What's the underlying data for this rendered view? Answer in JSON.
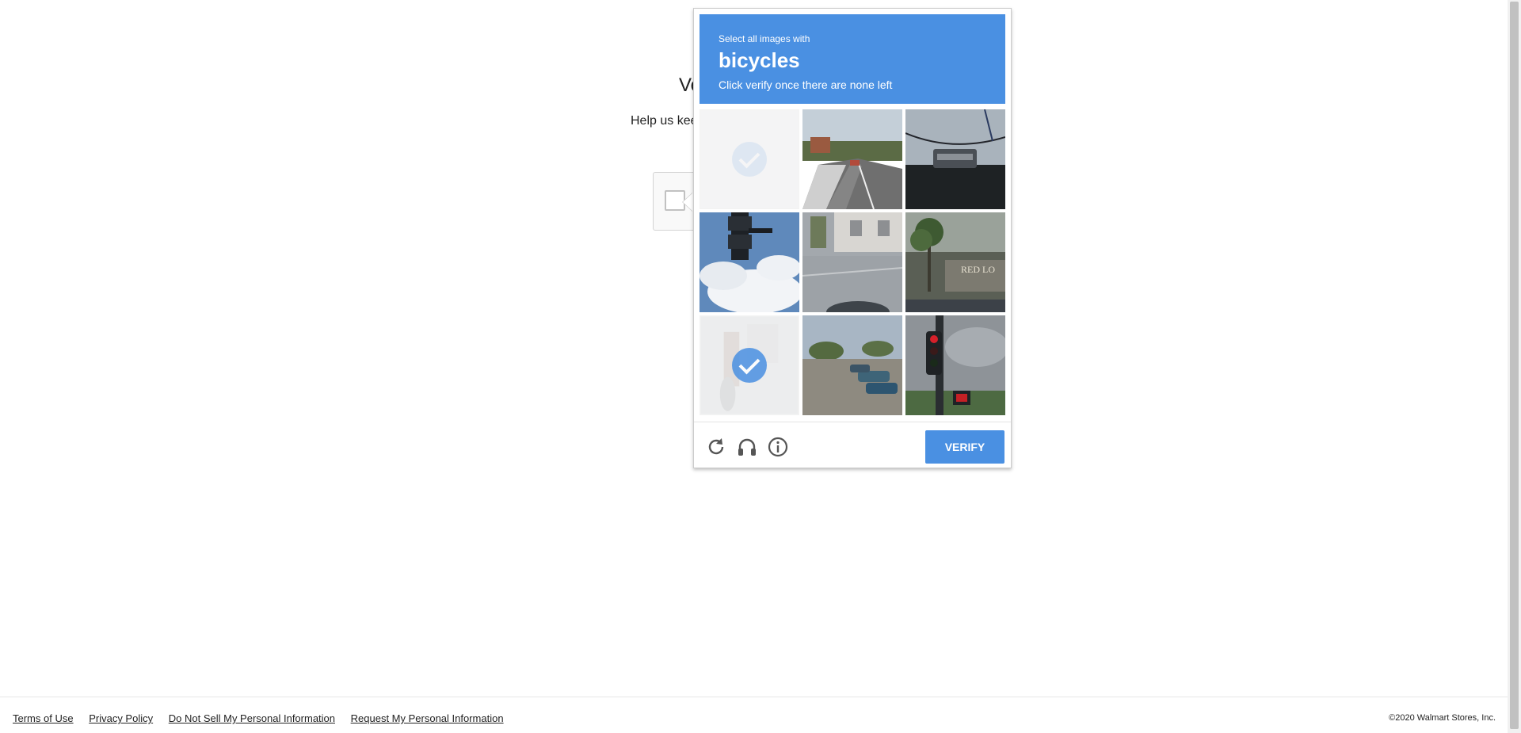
{
  "background": {
    "title": "Ve",
    "subtitle": "Help us kee"
  },
  "challenge": {
    "header": {
      "line1": "Select all images with",
      "target": "bicycles",
      "line2": "Click verify once there are none left"
    },
    "tiles": [
      {
        "scene": "loading-blank",
        "selected": true
      },
      {
        "scene": "road-curve",
        "selected": false
      },
      {
        "scene": "power-line",
        "selected": false
      },
      {
        "scene": "traffic-light-sky",
        "selected": false
      },
      {
        "scene": "building-sidewalk",
        "selected": false
      },
      {
        "scene": "red-lobster-palm",
        "selected": false
      },
      {
        "scene": "street-person-bicycle",
        "selected": true
      },
      {
        "scene": "parking-lot",
        "selected": false
      },
      {
        "scene": "traffic-signal-red",
        "selected": false
      }
    ],
    "footer": {
      "reload_icon": "reload-icon",
      "audio_icon": "headphones-icon",
      "info_icon": "info-icon",
      "verify_label": "VERIFY"
    },
    "accent_color": "#4a90e2"
  },
  "footer": {
    "links": [
      "Terms of Use",
      "Privacy Policy",
      "Do Not Sell My Personal Information",
      "Request My Personal Information"
    ],
    "copyright": "©2020 Walmart Stores, Inc."
  }
}
